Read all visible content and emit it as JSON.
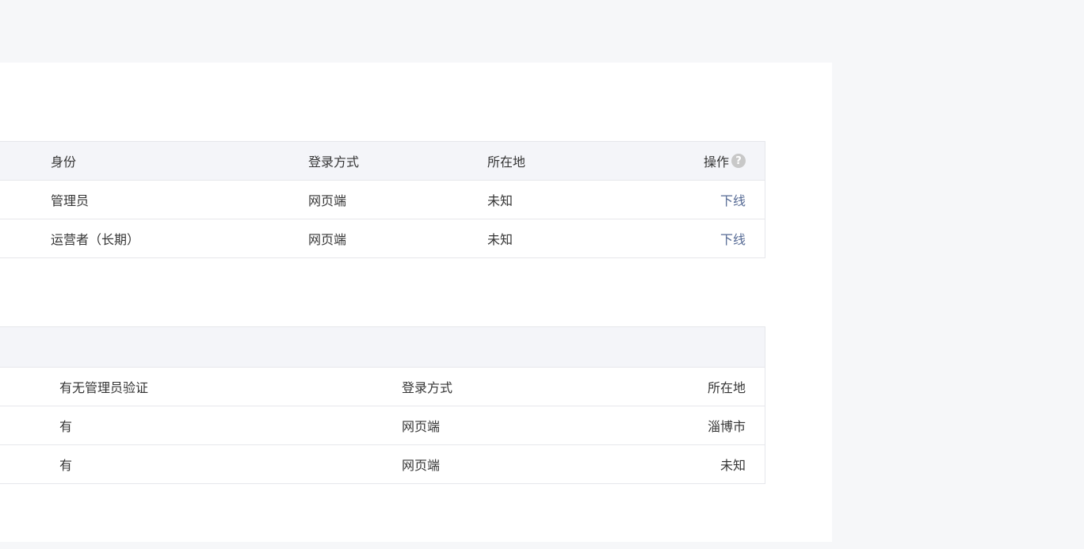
{
  "online_table": {
    "headers": {
      "identity": "身份",
      "login_method": "登录方式",
      "location": "所在地",
      "action": "操作"
    },
    "help_glyph": "?",
    "rows": [
      {
        "identity": "管理员",
        "login_method": "网页端",
        "location": "未知",
        "action": "下线"
      },
      {
        "identity": "运营者（长期）",
        "login_method": "网页端",
        "location": "未知",
        "action": "下线"
      }
    ]
  },
  "login_log_table": {
    "headers": {
      "admin_verify": "有无管理员验证",
      "login_method": "登录方式",
      "location": "所在地"
    },
    "rows": [
      {
        "admin_verify": "有",
        "login_method": "网页端",
        "location": "淄博市"
      },
      {
        "admin_verify": "有",
        "login_method": "网页端",
        "location": "未知"
      }
    ]
  },
  "colors": {
    "page_bg": "#f6f7f9",
    "header_bg": "#f4f5f9",
    "border": "#e6e7eb",
    "link": "#576b95",
    "text": "#353535"
  },
  "icons": {
    "action_help": "question-circle-icon"
  }
}
